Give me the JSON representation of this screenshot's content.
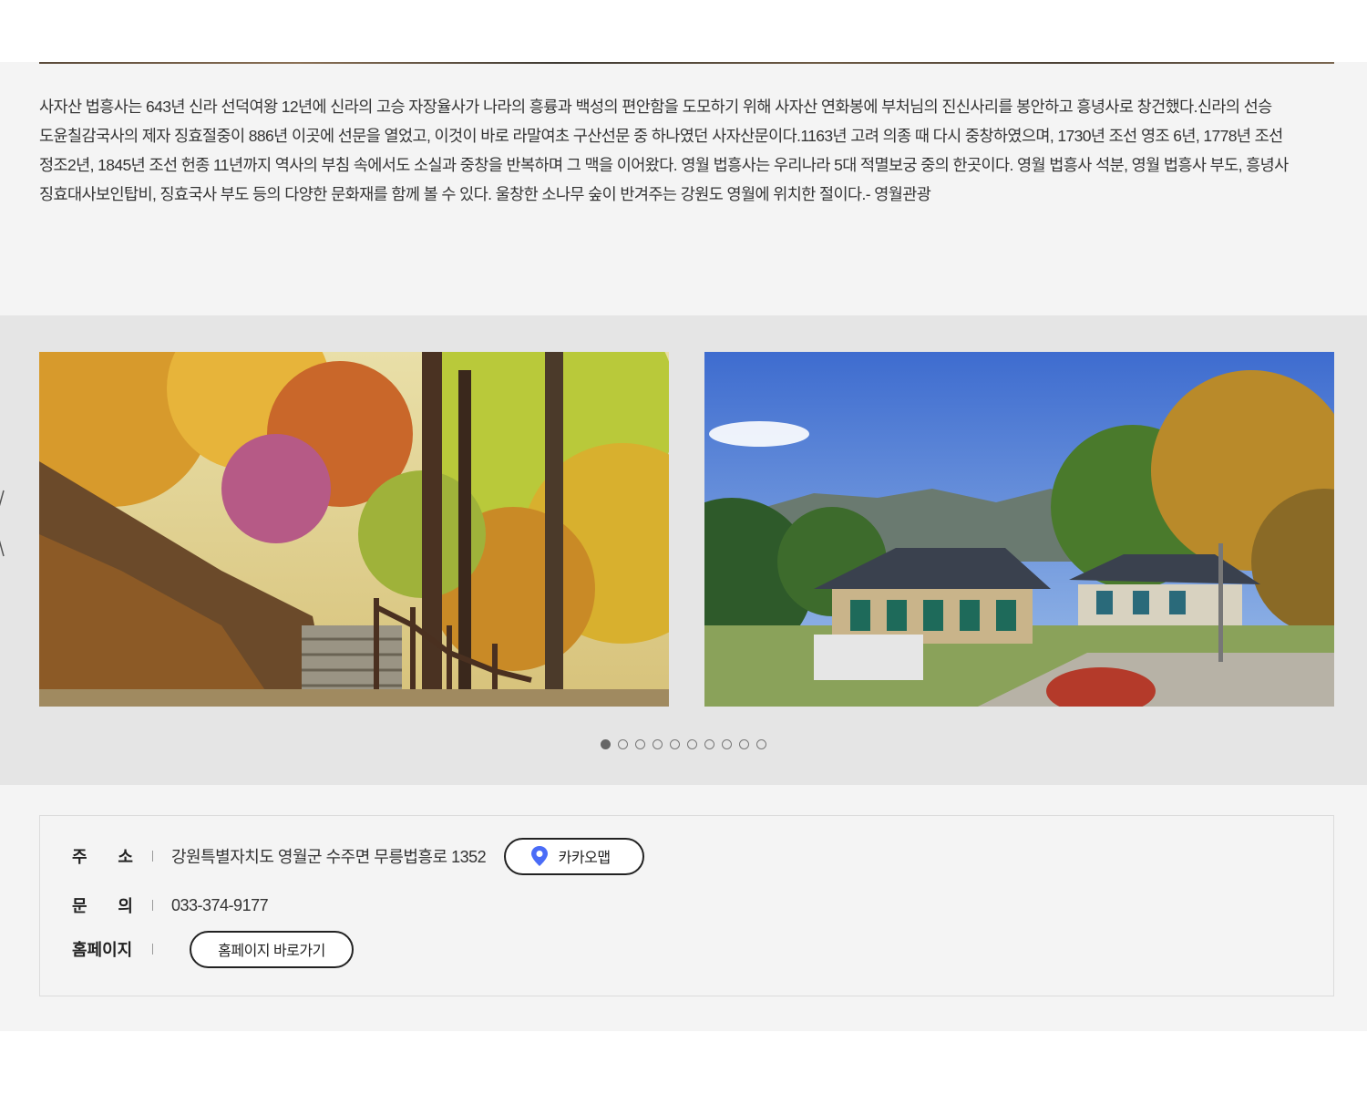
{
  "description": {
    "text": "사자산 법흥사는 643년 신라 선덕여왕 12년에 신라의 고승 자장율사가 나라의 흥륭과 백성의 편안함을 도모하기 위해 사자산 연화봉에 부처님의 진신사리를 봉안하고 흥녕사로 창건했다.신라의 선승 도윤칠감국사의 제자 징효절중이 886년 이곳에 선문을 열었고, 이것이 바로 라말여초 구산선문 중 하나였던 사자산문이다.1163년 고려 의종 때 다시 중창하였으며, 1730년 조선 영조 6년, 1778년 조선 정조2년, 1845년 조선 헌종 11년까지 역사의 부침 속에서도 소실과 중창을 반복하며 그 맥을 이어왔다. 영월 법흥사는 우리나라 5대 적멸보궁 중의 한곳이다. 영월 법흥사 석분, 영월 법흥사 부도, 흥녕사 징효대사보인탑비, 징효국사 부도 등의 다양한 문화재를 함께 볼 수 있다. 울창한 소나무 숲이 반겨주는 강원도 영월에 위치한 절이다.- 영월관광"
  },
  "gallery": {
    "slides": [
      {
        "subject": "autumn forest stairway"
      },
      {
        "subject": "temple buildings under blue sky"
      }
    ],
    "dot_count": 10,
    "active_dot": 0,
    "prev_icon": "chevron-left-icon"
  },
  "info": {
    "address": {
      "label": "주 소",
      "value": "강원특별자치도 영월군 수주면 무릉법흥로 1352",
      "map_button": "카카오맵",
      "map_icon": "map-pin-icon",
      "pin_color": "#4a6cf7"
    },
    "phone": {
      "label": "문 의",
      "value": "033-374-9177"
    },
    "homepage": {
      "label": "홈페이지",
      "button": "홈페이지 바로가기"
    }
  }
}
